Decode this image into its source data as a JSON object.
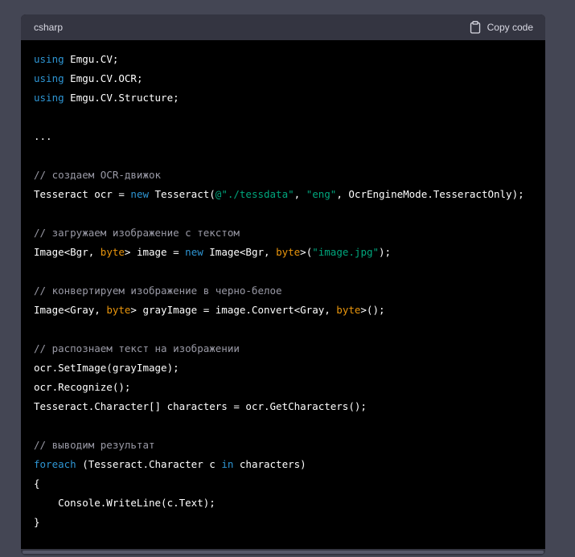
{
  "code_block": {
    "language": "csharp",
    "copy_label": "Copy code",
    "copy_icon": "clipboard-icon",
    "lines": [
      [
        {
          "t": "keyword",
          "v": "using"
        },
        {
          "t": "plain",
          "v": " Emgu.CV;"
        }
      ],
      [
        {
          "t": "keyword",
          "v": "using"
        },
        {
          "t": "plain",
          "v": " Emgu.CV.OCR;"
        }
      ],
      [
        {
          "t": "keyword",
          "v": "using"
        },
        {
          "t": "plain",
          "v": " Emgu.CV.Structure;"
        }
      ],
      [],
      [
        {
          "t": "plain",
          "v": "..."
        }
      ],
      [],
      [
        {
          "t": "comment",
          "v": "// создаем OCR-движок"
        }
      ],
      [
        {
          "t": "plain",
          "v": "Tesseract ocr = "
        },
        {
          "t": "keyword",
          "v": "new"
        },
        {
          "t": "plain",
          "v": " Tesseract("
        },
        {
          "t": "string",
          "v": "@\"./tessdata\""
        },
        {
          "t": "plain",
          "v": ", "
        },
        {
          "t": "string",
          "v": "\"eng\""
        },
        {
          "t": "plain",
          "v": ", OcrEngineMode.TesseractOnly);"
        }
      ],
      [],
      [
        {
          "t": "comment",
          "v": "// загружаем изображение с текстом"
        }
      ],
      [
        {
          "t": "plain",
          "v": "Image<Bgr, "
        },
        {
          "t": "type",
          "v": "byte"
        },
        {
          "t": "plain",
          "v": "> image = "
        },
        {
          "t": "keyword",
          "v": "new"
        },
        {
          "t": "plain",
          "v": " Image<Bgr, "
        },
        {
          "t": "type",
          "v": "byte"
        },
        {
          "t": "plain",
          "v": ">("
        },
        {
          "t": "string",
          "v": "\"image.jpg\""
        },
        {
          "t": "plain",
          "v": ");"
        }
      ],
      [],
      [
        {
          "t": "comment",
          "v": "// конвертируем изображение в черно-белое"
        }
      ],
      [
        {
          "t": "plain",
          "v": "Image<Gray, "
        },
        {
          "t": "type",
          "v": "byte"
        },
        {
          "t": "plain",
          "v": "> grayImage = image.Convert<Gray, "
        },
        {
          "t": "type",
          "v": "byte"
        },
        {
          "t": "plain",
          "v": ">();"
        }
      ],
      [],
      [
        {
          "t": "comment",
          "v": "// распознаем текст на изображении"
        }
      ],
      [
        {
          "t": "plain",
          "v": "ocr.SetImage(grayImage);"
        }
      ],
      [
        {
          "t": "plain",
          "v": "ocr.Recognize();"
        }
      ],
      [
        {
          "t": "plain",
          "v": "Tesseract.Character[] characters = ocr.GetCharacters();"
        }
      ],
      [],
      [
        {
          "t": "comment",
          "v": "// выводим результат"
        }
      ],
      [
        {
          "t": "keyword",
          "v": "foreach"
        },
        {
          "t": "plain",
          "v": " (Tesseract.Character c "
        },
        {
          "t": "keyword",
          "v": "in"
        },
        {
          "t": "plain",
          "v": " characters)"
        }
      ],
      [
        {
          "t": "plain",
          "v": "{"
        }
      ],
      [
        {
          "t": "plain",
          "v": "    Console.WriteLine(c.Text);"
        }
      ],
      [
        {
          "t": "plain",
          "v": "}"
        }
      ]
    ]
  },
  "colors": {
    "page_background": "#444654",
    "header_background": "#343541",
    "code_background": "#000000",
    "keyword": "#2e95d3",
    "type": "#e9950c",
    "string": "#00a67d",
    "comment": "#9a9aa6"
  }
}
